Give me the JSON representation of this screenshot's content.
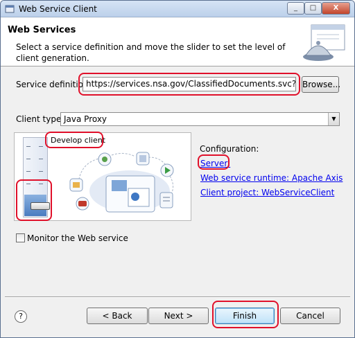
{
  "window": {
    "title": "Web Service Client",
    "min_glyph": "_",
    "max_glyph": "□",
    "close_glyph": "X"
  },
  "header": {
    "title": "Web Services",
    "description": "Select a service definition and move the slider to set the level of client generation."
  },
  "service": {
    "label": "Service definition:",
    "value": "https://services.nsa.gov/ClassifiedDocuments.svc?wsdl",
    "browse_label": "Browse..."
  },
  "client_type": {
    "label": "Client type:",
    "value": "Java Proxy"
  },
  "slider": {
    "level_label": "Develop client",
    "level_fraction": 0.2
  },
  "configuration": {
    "heading": "Configuration:",
    "server_link": "Server:",
    "runtime_link": "Web service runtime: Apache Axis",
    "project_link": "Client project: WebServiceClient"
  },
  "monitor": {
    "label": "Monitor the Web service",
    "checked": false
  },
  "footer": {
    "help": "?",
    "back": "< Back",
    "next": "Next >",
    "finish": "Finish",
    "cancel": "Cancel"
  },
  "colors": {
    "highlight": "#e0102a",
    "link": "#0000ee"
  }
}
